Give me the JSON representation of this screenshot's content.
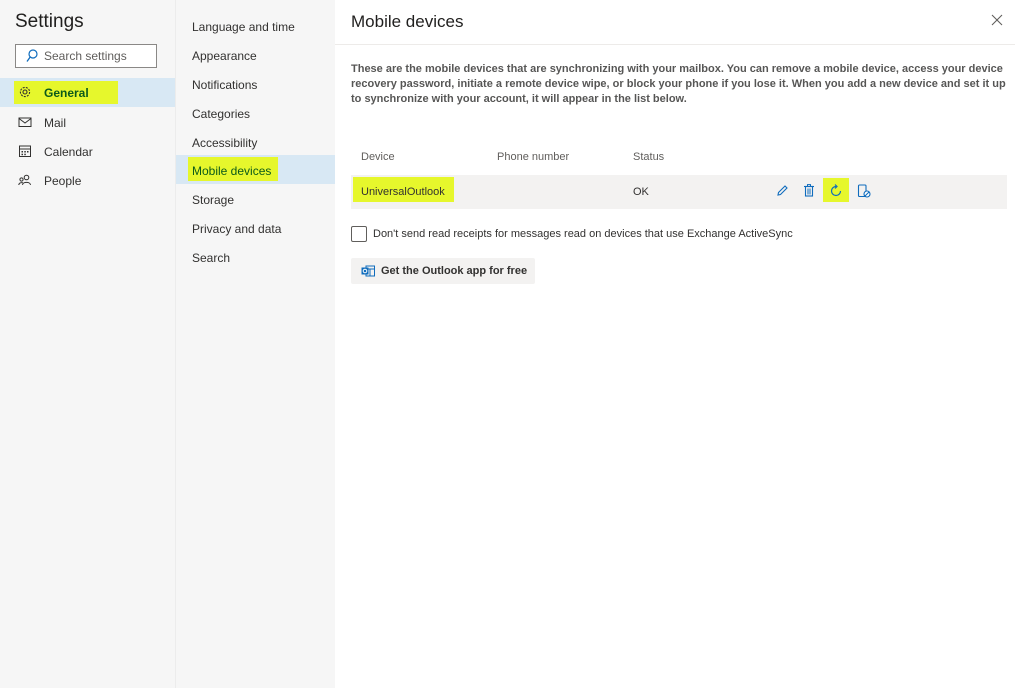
{
  "settings": {
    "title": "Settings",
    "search_placeholder": "Search settings",
    "categories": [
      {
        "label": "General",
        "icon": "gear-icon",
        "selected": true
      },
      {
        "label": "Mail",
        "icon": "mail-icon",
        "selected": false
      },
      {
        "label": "Calendar",
        "icon": "calendar-icon",
        "selected": false
      },
      {
        "label": "People",
        "icon": "people-icon",
        "selected": false
      }
    ]
  },
  "subnav": {
    "items": [
      {
        "label": "Language and time",
        "selected": false
      },
      {
        "label": "Appearance",
        "selected": false
      },
      {
        "label": "Notifications",
        "selected": false
      },
      {
        "label": "Categories",
        "selected": false
      },
      {
        "label": "Accessibility",
        "selected": false
      },
      {
        "label": "Mobile devices",
        "selected": true
      },
      {
        "label": "Storage",
        "selected": false
      },
      {
        "label": "Privacy and data",
        "selected": false
      },
      {
        "label": "Search",
        "selected": false
      }
    ]
  },
  "main": {
    "title": "Mobile devices",
    "description": "These are the mobile devices that are synchronizing with your mailbox. You can remove a mobile device, access your device recovery password, initiate a remote device wipe, or block your phone if you lose it. When you add a new device and set it up to synchronize with your account, it will appear in the list below.",
    "table": {
      "headers": {
        "device": "Device",
        "phone": "Phone number",
        "status": "Status"
      },
      "rows": [
        {
          "device": "UniversalOutlook",
          "phone": "",
          "status": "OK"
        }
      ],
      "actions": [
        "edit-icon",
        "delete-icon",
        "refresh-icon",
        "block-device-icon"
      ]
    },
    "checkbox_label": "Don't send read receipts for messages read on devices that use Exchange ActiveSync",
    "checkbox_checked": false,
    "get_app_label": "Get the Outlook app for free"
  },
  "colors": {
    "highlight": "#e6f72c",
    "selected_bg": "#d8e8f4",
    "accent": "#0f6cbd"
  }
}
